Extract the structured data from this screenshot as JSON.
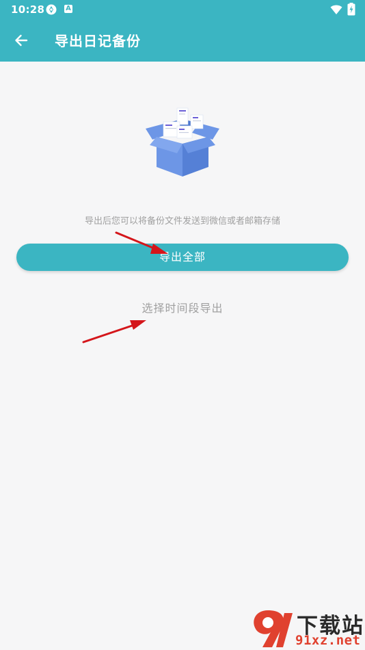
{
  "status_bar": {
    "time": "10:28",
    "a_badge": "A"
  },
  "app_bar": {
    "title": "导出日记备份"
  },
  "main": {
    "hint": "导出后您可以将备份文件发送到微信或者邮箱存储",
    "export_all_label": "导出全部",
    "select_period_label": "选择时间段导出"
  },
  "watermark": {
    "line1": "下载站",
    "line2": "91xz.net"
  },
  "colors": {
    "accent": "#3bb5c2",
    "background": "#f6f6f7",
    "muted_text": "#a0a0a0",
    "arrow": "#d4161b"
  }
}
